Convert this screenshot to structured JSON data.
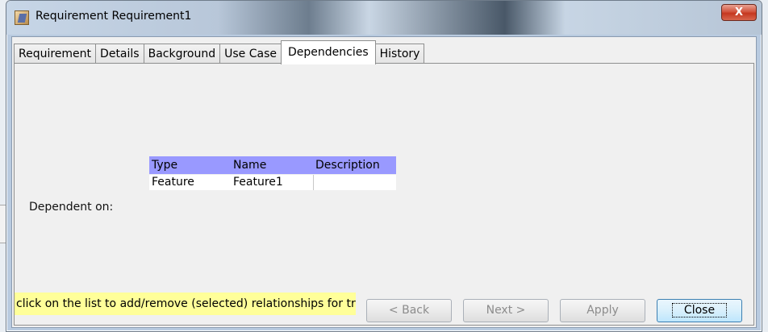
{
  "window": {
    "title": "Requirement Requirement1",
    "close_glyph": "X"
  },
  "tabs": [
    {
      "label": "Requirement"
    },
    {
      "label": "Details"
    },
    {
      "label": "Background"
    },
    {
      "label": "Use Case"
    },
    {
      "label": "Dependencies",
      "active": true
    },
    {
      "label": "History"
    }
  ],
  "dependencies": {
    "label": "Dependent on:",
    "columns": [
      "Type",
      "Name",
      "Description"
    ],
    "rows": [
      {
        "type": "Feature",
        "name": "Feature1",
        "description": ""
      }
    ],
    "header_color": "#9999ff"
  },
  "hint": "click on the list to add/remove (selected) relationships for tr",
  "buttons": {
    "back": "< Back",
    "next": "Next >",
    "apply": "Apply",
    "close": "Close"
  }
}
